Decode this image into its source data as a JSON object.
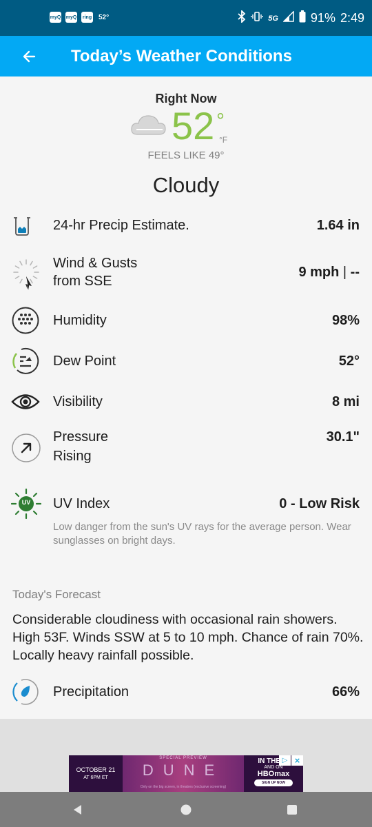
{
  "status_bar": {
    "notifications": [
      "myQ",
      "myQ",
      "ring"
    ],
    "notification_temp": "52°",
    "network": "5G",
    "battery": "91%",
    "time": "2:49",
    "bar_color": "#005b83"
  },
  "header": {
    "title": "Today’s Weather Conditions",
    "color": "#03a9f4"
  },
  "current": {
    "label": "Right Now",
    "temperature": "52",
    "degree_symbol": "°",
    "unit": "°F",
    "feels_like": "FEELS LIKE 49°",
    "condition": "Cloudy",
    "temp_color": "#8bc34a"
  },
  "details": [
    {
      "label": "24-hr Precip Estimate.",
      "value": "1.64 in",
      "icon": "precip-cup-icon"
    },
    {
      "label": "Wind & Gusts",
      "sublabel": "from SSE",
      "value": "9 mph",
      "gust": "--",
      "icon": "wind-dial-icon"
    },
    {
      "label": "Humidity",
      "value": "98%",
      "icon": "humidity-icon"
    },
    {
      "label": "Dew Point",
      "value": "52°",
      "icon": "dew-point-icon"
    },
    {
      "label": "Visibility",
      "value": "8 mi",
      "icon": "eye-icon"
    },
    {
      "label": "Pressure",
      "sublabel": "Rising",
      "value": "30.1\"",
      "icon": "pressure-arrow-icon"
    },
    {
      "label": "UV Index",
      "value": "0 - Low Risk",
      "icon": "uv-sun-icon",
      "icon_text": "UV",
      "uv_color": "#2e7d32"
    }
  ],
  "uv_description": "Low danger from the sun's UV rays for the average person. Wear sunglasses on bright days.",
  "forecast": {
    "heading": "Today's Forecast",
    "text": "Considerable cloudiness with occasional rain showers. High 53F. Winds SSW at 5 to 10 mph. Chance of rain 70%.  Locally heavy rainfall possible.",
    "precip_label": "Precipitation",
    "precip_value": "66%"
  },
  "ad": {
    "date": "OCTOBER 21",
    "time": "AT 6PM ET",
    "top": "SPECIAL PREVIEW",
    "title": "DUNE",
    "small": "Only on the big screen, in theatres (exclusive screening)",
    "right_a": "IN THEAT",
    "right_b": "AND ON",
    "right_c": "HBOmax",
    "signup": "SIGN UP NOW",
    "choices_icon": "adchoices-icon",
    "close_icon": "close-icon"
  }
}
